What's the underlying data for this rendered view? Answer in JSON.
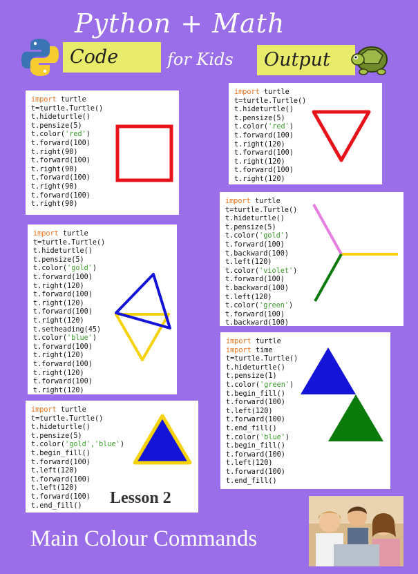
{
  "header": {
    "title": "Python + Math",
    "code_tag": "Code",
    "for_kids": "for Kids",
    "output_tag": "Output"
  },
  "panels": [
    {
      "id": "square",
      "lines": [
        [
          "import",
          " turtle"
        ],
        [
          "",
          "t=turtle.Turtle()"
        ],
        [
          "",
          "t.hideturtle()"
        ],
        [
          "",
          "t.pensize(5)"
        ],
        [
          "",
          "t.color(",
          "'red'",
          ")"
        ],
        [
          "",
          "t.forward(100)"
        ],
        [
          "",
          "t.right(90)"
        ],
        [
          "",
          "t.forward(100)"
        ],
        [
          "",
          "t.right(90)"
        ],
        [
          "",
          "t.forward(100)"
        ],
        [
          "",
          "t.right(90)"
        ],
        [
          "",
          "t.forward(100)"
        ],
        [
          "",
          "t.right(90)"
        ]
      ]
    },
    {
      "id": "red-triangle",
      "lines": [
        [
          "import",
          " turtle"
        ],
        [
          "",
          "t=turtle.Turtle()"
        ],
        [
          "",
          "t.hideturtle()"
        ],
        [
          "",
          "t.pensize(5)"
        ],
        [
          "",
          "t.color(",
          "'red'",
          ")"
        ],
        [
          "",
          "t.forward(100)"
        ],
        [
          "",
          "t.right(120)"
        ],
        [
          "",
          "t.forward(100)"
        ],
        [
          "",
          "t.right(120)"
        ],
        [
          "",
          "t.forward(100)"
        ],
        [
          "",
          "t.right(120)"
        ]
      ]
    },
    {
      "id": "tri-line",
      "lines": [
        [
          "import",
          " turtle"
        ],
        [
          "",
          "t=turtle.Turtle()"
        ],
        [
          "",
          "t.hideturtle()"
        ],
        [
          "",
          "t.pensize(5)"
        ],
        [
          "",
          "t.color(",
          "'gold'",
          ")"
        ],
        [
          "",
          "t.forward(100)"
        ],
        [
          "",
          "t.backward(100)"
        ],
        [
          "",
          "t.left(120)"
        ],
        [
          "",
          "t.color(",
          "'violet'",
          ")"
        ],
        [
          "",
          "t.forward(100)"
        ],
        [
          "",
          "t.backward(100)"
        ],
        [
          "",
          "t.left(120)"
        ],
        [
          "",
          "t.color(",
          "'green'",
          ")"
        ],
        [
          "",
          "t.forward(100)"
        ],
        [
          "",
          "t.backward(100)"
        ]
      ]
    },
    {
      "id": "gold-blue",
      "lines": [
        [
          "import",
          " turtle"
        ],
        [
          "",
          "t=turtle.Turtle()"
        ],
        [
          "",
          "t.hideturtle()"
        ],
        [
          "",
          "t.pensize(5)"
        ],
        [
          "",
          "t.color(",
          "'gold'",
          ")"
        ],
        [
          "",
          "t.forward(100)"
        ],
        [
          "",
          "t.right(120)"
        ],
        [
          "",
          "t.forward(100)"
        ],
        [
          "",
          "t.right(120)"
        ],
        [
          "",
          "t.forward(100)"
        ],
        [
          "",
          "t.right(120)"
        ],
        [
          "",
          "t.setheading(45)"
        ],
        [
          "",
          "t.color(",
          "'blue'",
          ")"
        ],
        [
          "",
          "t.forward(100)"
        ],
        [
          "",
          "t.right(120)"
        ],
        [
          "",
          "t.forward(100)"
        ],
        [
          "",
          "t.right(120)"
        ],
        [
          "",
          "t.forward(100)"
        ],
        [
          "",
          "t.right(120)"
        ]
      ]
    },
    {
      "id": "fills",
      "lines": [
        [
          "import",
          " turtle"
        ],
        [
          "import",
          " time"
        ],
        [
          "",
          "t=turtle.Turtle()"
        ],
        [
          "",
          "t.hideturtle()"
        ],
        [
          "",
          "t.pensize(1)"
        ],
        [
          "",
          "t.color(",
          "'green'",
          ")"
        ],
        [
          "",
          "t.begin_fill()"
        ],
        [
          "",
          "t.forward(100)"
        ],
        [
          "",
          "t.left(120)"
        ],
        [
          "",
          "t.forward(100)"
        ],
        [
          "",
          "t.end_fill()"
        ],
        [
          "",
          "t.color(",
          "'blue'",
          ")"
        ],
        [
          "",
          "t.begin_fill()"
        ],
        [
          "",
          "t.forward(100)"
        ],
        [
          "",
          "t.left(120)"
        ],
        [
          "",
          "t.forward(100)"
        ],
        [
          "",
          "t.end_fill()"
        ]
      ]
    },
    {
      "id": "filled-gold",
      "lines": [
        [
          "import",
          " turtle"
        ],
        [
          "",
          "t=turtle.Turtle()"
        ],
        [
          "",
          "t.hideturtle()"
        ],
        [
          "",
          "t.pensize(5)"
        ],
        [
          "",
          "t.color(",
          "'gold','blue'",
          ")"
        ],
        [
          "",
          "t.begin_fill()"
        ],
        [
          "",
          "t.forward(100)"
        ],
        [
          "",
          "t.left(120)"
        ],
        [
          "",
          "t.forward(100)"
        ],
        [
          "",
          "t.left(120)"
        ],
        [
          "",
          "t.forward(100)"
        ],
        [
          "",
          "t.end_fill()"
        ]
      ]
    }
  ],
  "lesson_label": "Lesson 2",
  "footer": "Main Colour Commands",
  "colors": {
    "background": "#9a6ee8",
    "tag": "#e8ec6a",
    "red": "#e8121a",
    "blue": "#1414d8",
    "gold": "#f5d20a",
    "green": "#0a7a0a",
    "violet": "#e57ee0"
  }
}
